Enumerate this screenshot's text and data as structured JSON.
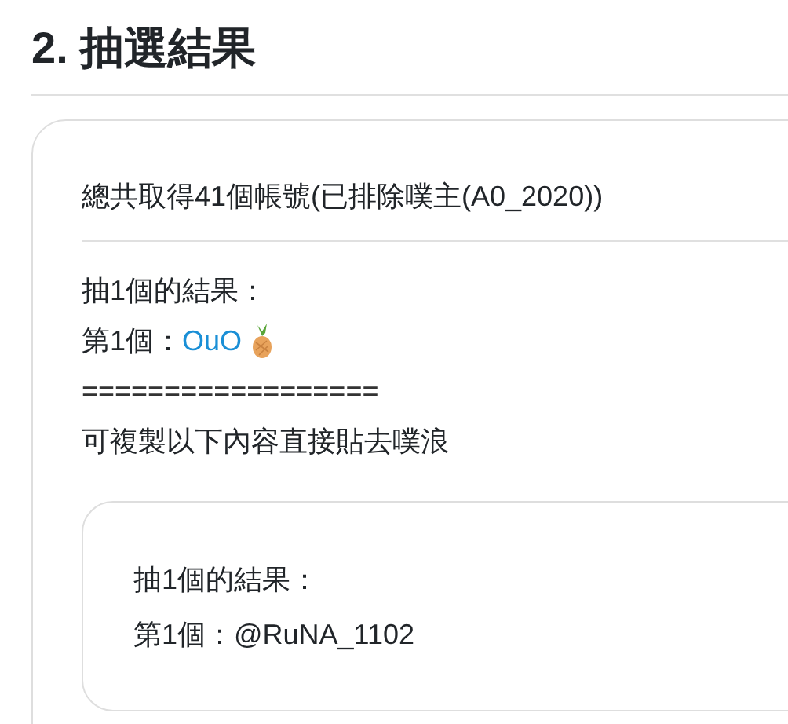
{
  "heading": "2. 抽選結果",
  "summary": "總共取得41個帳號(已排除噗主(A0_2020))",
  "result_title": "抽1個的結果：",
  "results": [
    {
      "prefix": "第1個：",
      "name": "OuO"
    }
  ],
  "separator": "==================",
  "copy_hint": "可複製以下內容直接貼去噗浪",
  "copy_box": {
    "lines": [
      "抽1個的結果：",
      "第1個：@RuNA_1102"
    ]
  }
}
